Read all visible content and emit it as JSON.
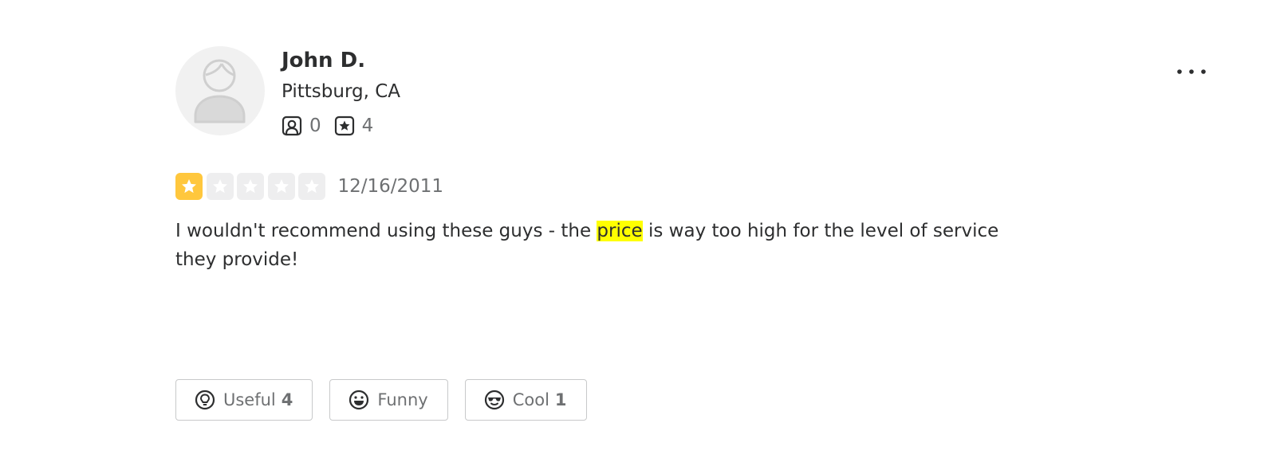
{
  "user": {
    "name": "John D.",
    "location": "Pittsburg, CA",
    "friends_count": "0",
    "reviews_count": "4"
  },
  "review": {
    "rating": 1,
    "rating_max": 5,
    "date": "12/16/2011",
    "text_before": "I wouldn't recommend using these guys - the ",
    "text_highlight": "price",
    "text_after": " is way too high for the level of service they provide!"
  },
  "reactions": {
    "useful": {
      "label": "Useful",
      "count": "4"
    },
    "funny": {
      "label": "Funny",
      "count": ""
    },
    "cool": {
      "label": "Cool",
      "count": "1"
    }
  },
  "colors": {
    "star_filled": "#ffc73d",
    "star_empty": "#eeeeef",
    "highlight": "#ffff00"
  },
  "icons": {
    "menu": "more-horizontal-icon",
    "friends": "friends-icon",
    "reviews": "review-star-icon",
    "useful": "lightbulb-icon",
    "funny": "smile-icon",
    "cool": "sunglasses-icon"
  }
}
